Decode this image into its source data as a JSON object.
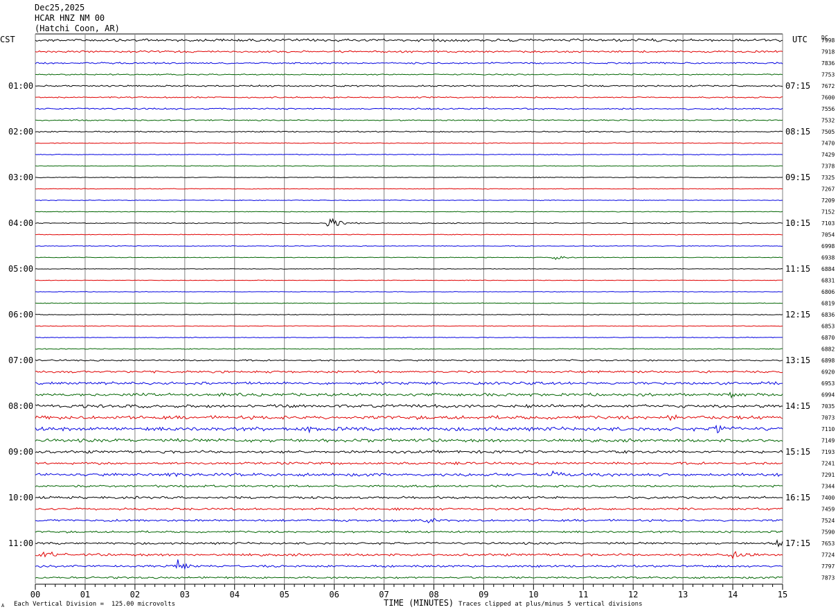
{
  "header": {
    "date": "Dec25,2025",
    "station": "HCAR HNZ NM 00",
    "location": "(Hatchi Coon, AR)"
  },
  "left_tz": "CST",
  "right_tz": "UTC",
  "dc_label": "DC",
  "footer": {
    "left_mark": "A",
    "scale_note": "Each Vertical Division =  125.00 microvolts",
    "xlabel": "TIME (MINUTES)",
    "clip_note": "Traces clipped at plus/minus 5 vertical divisions"
  },
  "colors": {
    "cycle": [
      "#000000",
      "#e00000",
      "#0000e0",
      "#006400"
    ],
    "grid": "#808080"
  },
  "chart_data": {
    "type": "line",
    "title": "HCAR HNZ NM 00",
    "xlabel": "TIME (MINUTES)",
    "x_range": [
      0,
      15
    ],
    "x_ticks": [
      "00",
      "01",
      "02",
      "03",
      "04",
      "05",
      "06",
      "07",
      "08",
      "09",
      "10",
      "11",
      "12",
      "13",
      "14",
      "15"
    ],
    "traces_per_hour": 4,
    "minutes_per_trace": 15,
    "left_hour_labels": [
      "01:00",
      "02:00",
      "03:00",
      "04:00",
      "05:00",
      "06:00",
      "07:00",
      "08:00",
      "09:00",
      "10:00",
      "11:00"
    ],
    "right_hour_labels": [
      "07:15",
      "08:15",
      "09:15",
      "10:15",
      "11:15",
      "12:15",
      "13:15",
      "14:15",
      "15:15",
      "16:15",
      "17:15"
    ],
    "dc_offsets": [
      "7998",
      "7918",
      "7836",
      "7753",
      "7672",
      "7600",
      "7556",
      "7532",
      "7505",
      "7470",
      "7429",
      "7378",
      "7325",
      "7267",
      "7209",
      "7152",
      "7103",
      "7054",
      "6998",
      "6938",
      "6884",
      "6831",
      "6806",
      "6819",
      "6836",
      "6853",
      "6870",
      "6882",
      "6898",
      "6920",
      "6953",
      "6994",
      "7035",
      "7073",
      "7110",
      "7149",
      "7193",
      "7241",
      "7291",
      "7344",
      "7400",
      "7459",
      "7524",
      "7590",
      "7653",
      "7724",
      "7797",
      "7873"
    ],
    "noise_levels": [
      2.2,
      1.6,
      1.4,
      1.0,
      1.3,
      1.1,
      1.3,
      1.0,
      1.0,
      0.7,
      0.7,
      0.6,
      0.6,
      0.6,
      0.6,
      0.6,
      0.8,
      0.6,
      0.6,
      0.6,
      0.5,
      0.5,
      0.5,
      0.6,
      0.7,
      0.6,
      0.6,
      0.7,
      1.3,
      1.8,
      2.2,
      2.4,
      2.6,
      2.8,
      3.0,
      2.6,
      2.2,
      2.0,
      2.4,
      1.8,
      1.9,
      1.8,
      1.8,
      1.6,
      1.7,
      2.0,
      1.7,
      1.6
    ],
    "events": [
      {
        "trace": 16,
        "minute": 5.95,
        "amplitude": 9,
        "duration": 0.5
      },
      {
        "trace": 19,
        "minute": 10.45,
        "amplitude": 4,
        "duration": 0.4
      },
      {
        "trace": 34,
        "minute": 5.5,
        "amplitude": 4,
        "duration": 0.4
      },
      {
        "trace": 34,
        "minute": 13.7,
        "amplitude": 12,
        "duration": 0.25
      },
      {
        "trace": 33,
        "minute": 12.8,
        "amplitude": 4,
        "duration": 0.4
      },
      {
        "trace": 31,
        "minute": 14.0,
        "amplitude": 5,
        "duration": 0.5
      },
      {
        "trace": 38,
        "minute": 10.4,
        "amplitude": 5,
        "duration": 0.5
      },
      {
        "trace": 38,
        "minute": 2.7,
        "amplitude": 3,
        "duration": 0.5
      },
      {
        "trace": 42,
        "minute": 7.9,
        "amplitude": 7,
        "duration": 0.3
      },
      {
        "trace": 44,
        "minute": 14.9,
        "amplitude": 6,
        "duration": 0.25
      },
      {
        "trace": 45,
        "minute": 0.2,
        "amplitude": 6,
        "duration": 0.5
      },
      {
        "trace": 45,
        "minute": 14.0,
        "amplitude": 6,
        "duration": 0.6
      },
      {
        "trace": 46,
        "minute": 2.85,
        "amplitude": 11,
        "duration": 0.4
      }
    ]
  }
}
